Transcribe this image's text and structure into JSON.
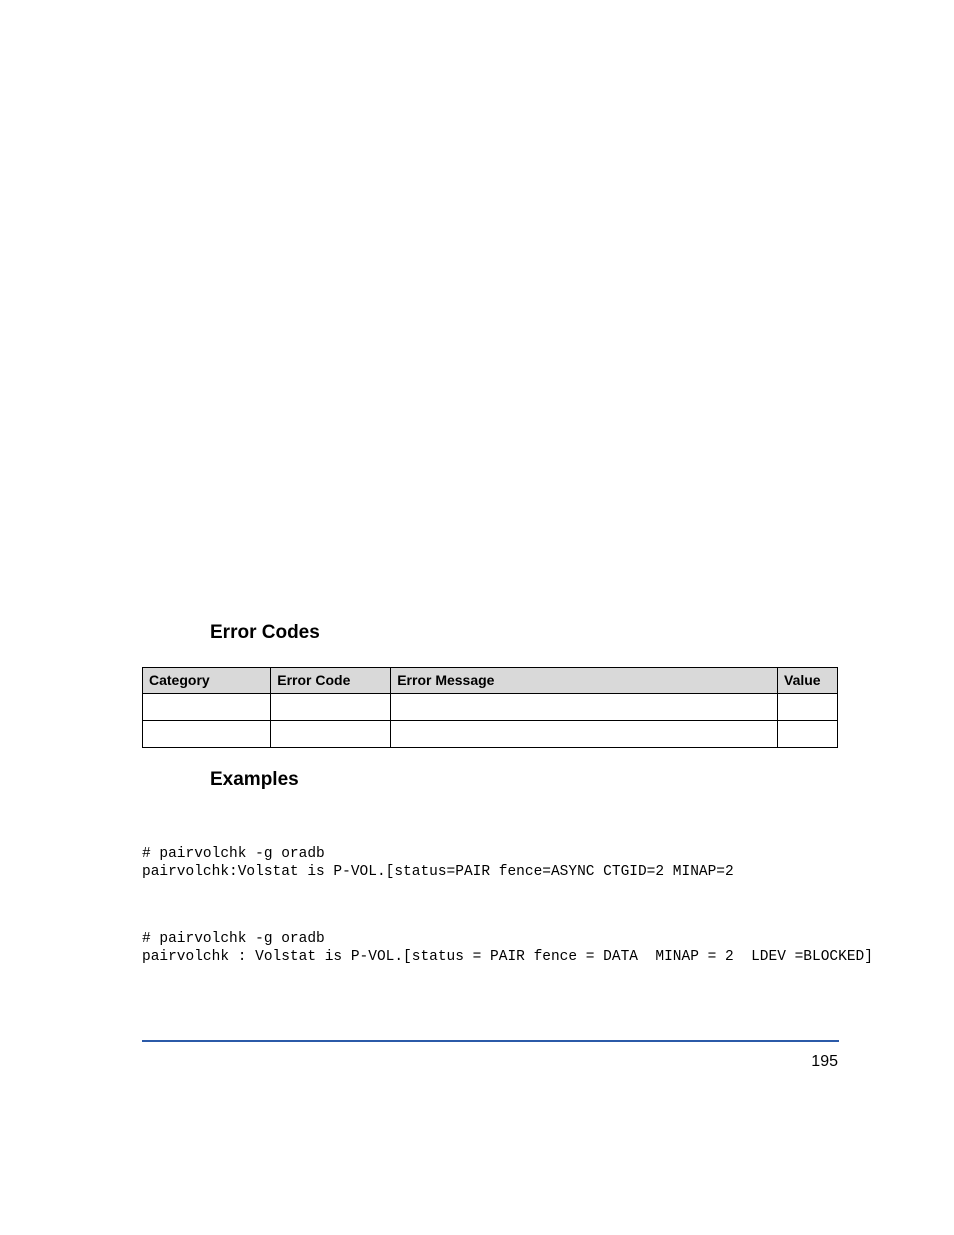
{
  "headings": {
    "error_codes": "Error Codes",
    "examples": "Examples"
  },
  "table": {
    "headers": {
      "category": "Category",
      "error_code": "Error Code",
      "error_message": "Error Message",
      "value": "Value"
    },
    "rows": [
      {
        "category": "",
        "error_code": "",
        "error_message": "",
        "value": ""
      },
      {
        "category": "",
        "error_code": "",
        "error_message": "",
        "value": ""
      }
    ]
  },
  "code_examples": {
    "example1": "# pairvolchk -g oradb\npairvolchk:Volstat is P-VOL.[status=PAIR fence=ASYNC CTGID=2 MINAP=2",
    "example2": "# pairvolchk -g oradb\npairvolchk : Volstat is P-VOL.[status = PAIR fence = DATA  MINAP = 2  LDEV =BLOCKED]"
  },
  "page_number": "195"
}
